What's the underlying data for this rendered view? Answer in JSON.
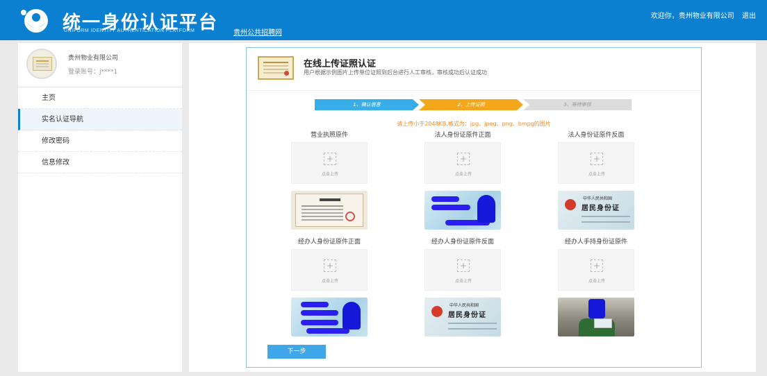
{
  "header": {
    "title": "统一身份认证平台",
    "subtitle": "UNIFORM IDENTITY AUTHENTICATION PLATFORM",
    "link": "贵州公共招聘网",
    "welcome": "欢迎你，贵州物业有限公司",
    "logout": "退出"
  },
  "sidebar": {
    "company": "贵州物业有限公司",
    "account": "登录账号：j****1",
    "items": [
      {
        "label": "主页"
      },
      {
        "label": "实名认证导航"
      },
      {
        "label": "修改密码"
      },
      {
        "label": "信息修改"
      }
    ]
  },
  "main": {
    "title": "在线上传证照认证",
    "desc": "用户根据示例图片上传单位证照到后台进行人工审核，审核成功后认证成功",
    "steps": [
      "1、确认信息",
      "2、上传证照",
      "3、等待审核"
    ],
    "notice": "请上传小于2048KB,格式为：jpg、jpeg、png、bmpg的图片",
    "upload_text": "点击上传",
    "slots": [
      {
        "label": "营业执照原件"
      },
      {
        "label": "法人身份证原件正面"
      },
      {
        "label": "法人身份证原件反面"
      },
      {
        "label": "经办人身份证原件正面"
      },
      {
        "label": "经办人身份证原件反面"
      },
      {
        "label": "经办人手持身份证原件"
      }
    ],
    "id_card": {
      "top_text": "中华人民共和国",
      "main_text": "居民身份证"
    },
    "next_button": "下一步"
  },
  "colors": {
    "header": "#0b7fd0",
    "step_done": "#38aee8",
    "step_current": "#f4a71b",
    "step_pending": "#dcdcdc",
    "notice": "#f08a24",
    "button": "#3fa6e8"
  }
}
